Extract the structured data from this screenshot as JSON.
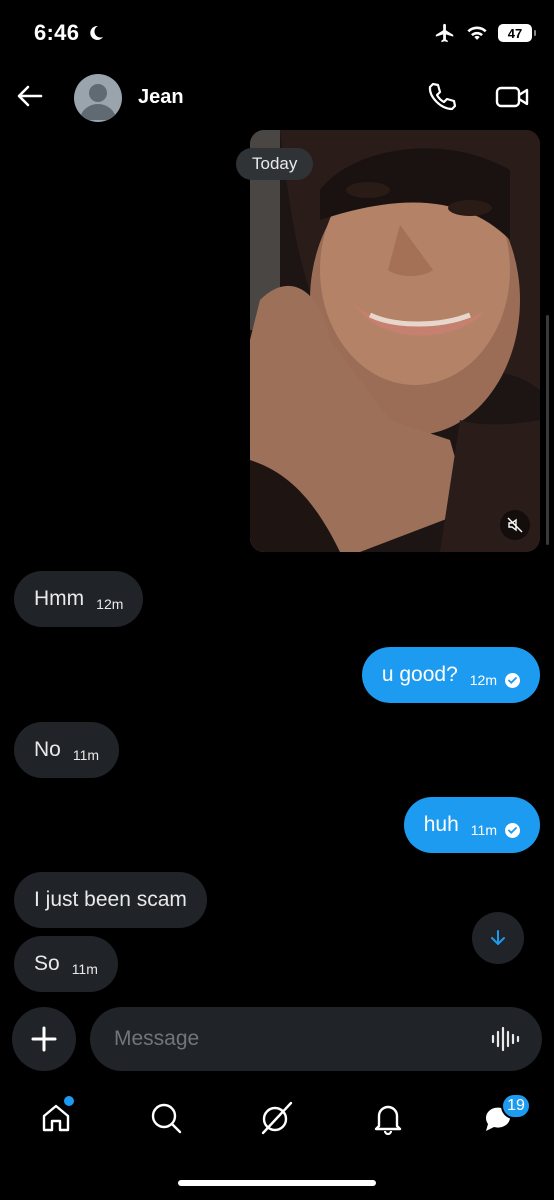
{
  "status_bar": {
    "time": "6:46",
    "battery": "47"
  },
  "header": {
    "contact_name": "Jean"
  },
  "conversation": {
    "date_divider": "Today",
    "messages": [
      {
        "side": "in",
        "text": "Hmm",
        "time": "12m"
      },
      {
        "side": "out",
        "text": "u good?",
        "time": "12m"
      },
      {
        "side": "in",
        "text": "No",
        "time": "11m"
      },
      {
        "side": "out",
        "text": "huh",
        "time": "11m"
      },
      {
        "side": "in",
        "text": "I just been scam",
        "time": ""
      },
      {
        "side": "in",
        "text": "So",
        "time": "11m"
      }
    ]
  },
  "composer": {
    "placeholder": "Message"
  },
  "tab_bar": {
    "messages_badge": "19"
  },
  "colors": {
    "accent": "#1d9bf0",
    "incoming_bubble": "#202327",
    "background": "#000000"
  }
}
